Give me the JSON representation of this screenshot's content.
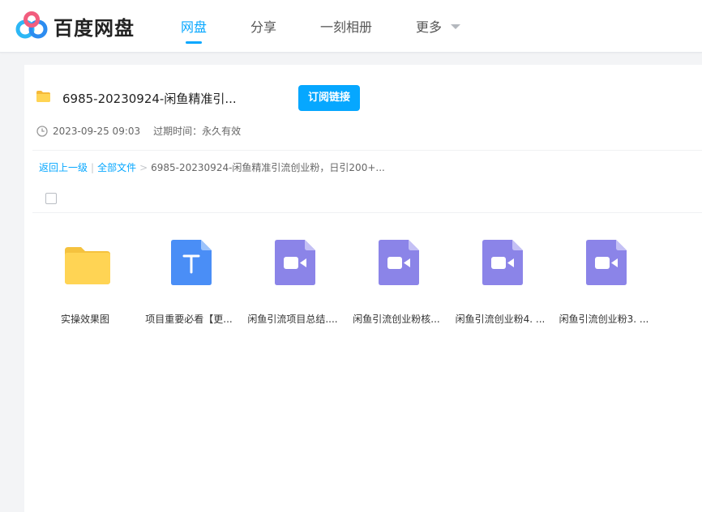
{
  "header": {
    "brand": "百度网盘",
    "nav": [
      {
        "label": "网盘",
        "active": true
      },
      {
        "label": "分享",
        "active": false
      },
      {
        "label": "一刻相册",
        "active": false
      },
      {
        "label": "更多",
        "active": false
      }
    ]
  },
  "share": {
    "title": "6985-20230924-闲鱼精准引...",
    "subscribe_label": "订阅链接",
    "date": "2023-09-25 09:03",
    "expire": "过期时间：永久有效"
  },
  "breadcrumb": {
    "back": "返回上一级",
    "sep": "|",
    "all": "全部文件",
    "arrow": ">",
    "current": "6985-20230924-闲鱼精准引流创业粉，日引200+..."
  },
  "files": [
    {
      "name": "实操效果图",
      "type": "folder-icon"
    },
    {
      "name": "项目重要必看【更...",
      "type": "doc-icon"
    },
    {
      "name": "闲鱼引流项目总结....",
      "type": "video-icon"
    },
    {
      "name": "闲鱼引流创业粉核...",
      "type": "video-icon"
    },
    {
      "name": "闲鱼引流创业粉4. ...",
      "type": "video-icon"
    },
    {
      "name": "闲鱼引流创业粉3. ...",
      "type": "video-icon"
    }
  ],
  "colors": {
    "accent": "#06a7ff",
    "folder": "#ffd454",
    "doc": "#4a8ef6",
    "video": "#8b84e8"
  }
}
